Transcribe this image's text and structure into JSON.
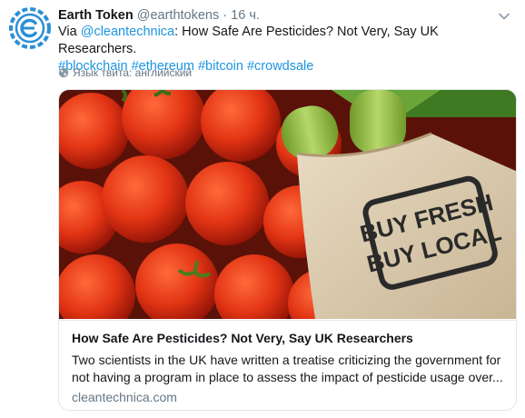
{
  "author": {
    "name": "Earth Token",
    "handle": "@earthtokens",
    "separator": "·",
    "time": "16 ч.",
    "avatar_icon": "earth-token-logo-icon"
  },
  "tweet": {
    "prefix": "Via ",
    "mention": "@cleantechnica",
    "text": ": How Safe Are Pesticides? Not Very, Say UK Researchers.",
    "hashtags": [
      "#blockchain",
      "#ethereum",
      "#bitcoin",
      "#crowdsale"
    ]
  },
  "language_note": "Язык твита: английский",
  "card": {
    "image_bag_text_line1": "BUY FRESH",
    "image_bag_text_line2": "BUY LOCAL",
    "title": "How Safe Are Pesticides? Not Very, Say UK Researchers",
    "description": "Two scientists in the UK have written a treatise criticizing the government for not having a program in place to assess the impact of pesticide usage over...",
    "domain": "cleantechnica.com"
  },
  "colors": {
    "link": "#1b95e0",
    "secondary_text": "#657786",
    "logo": "#2a8fd6",
    "border": "#e1e8ed"
  }
}
